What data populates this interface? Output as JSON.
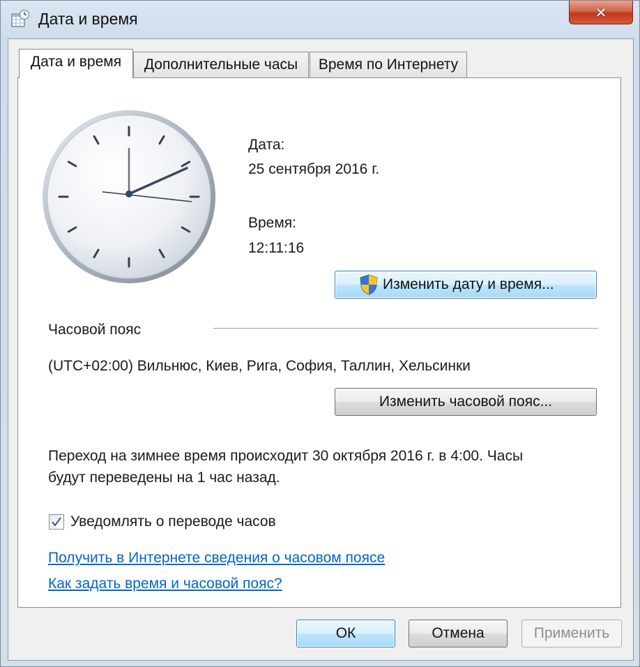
{
  "window": {
    "title": "Дата и время",
    "close_symbol": "✕"
  },
  "tabs": [
    {
      "label": "Дата и время",
      "active": true
    },
    {
      "label": "Дополнительные часы",
      "active": false
    },
    {
      "label": "Время по Интернету",
      "active": false
    }
  ],
  "datetime": {
    "date_label": "Дата:",
    "date_value": "25 сентября 2016 г.",
    "time_label": "Время:",
    "time_value": "12:11:16",
    "change_button": "Изменить дату и время..."
  },
  "timezone": {
    "section_label": "Часовой пояс",
    "value": "(UTC+02:00) Вильнюс, Киев, Рига, София, Таллин, Хельсинки",
    "change_button": "Изменить часовой пояс..."
  },
  "dst": {
    "line1": "Переход на зимнее время происходит 30 октября 2016 г. в 4:00. Часы",
    "line2": "будут переведены на 1 час назад.",
    "notify_label": "Уведомлять о переводе часов",
    "notify_checked": true
  },
  "links": {
    "timezone_info": "Получить в Интернете сведения о часовом поясе",
    "how_to": "Как задать время и часовой пояс?"
  },
  "buttons": {
    "ok": "ОК",
    "cancel": "Отмена",
    "apply": "Применить"
  },
  "icons": {
    "app": "calendar-clock-icon",
    "shield": "uac-shield-icon",
    "close": "close-icon",
    "check": "checkmark-icon"
  },
  "colors": {
    "link": "#0066cc",
    "default_button_border": "#3c7fb1",
    "close_button": "#c0391e"
  }
}
